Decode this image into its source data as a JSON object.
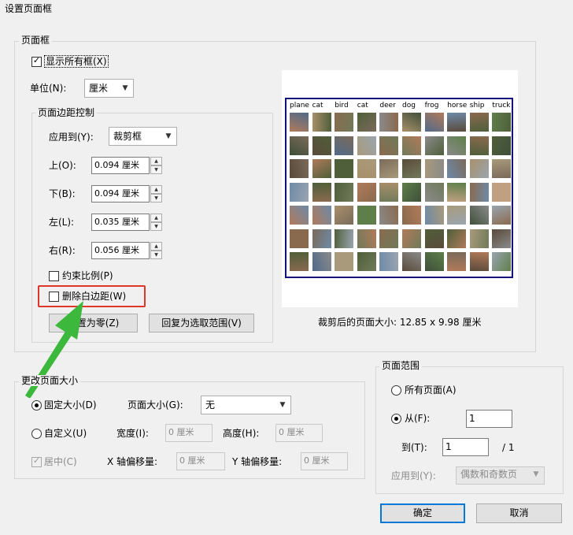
{
  "window": {
    "title": "设置页面框"
  },
  "page_box_group": {
    "title": "页面框",
    "show_all": {
      "label": "显示所有框(X)",
      "checked": true
    },
    "unit": {
      "label": "单位(N):",
      "value": "厘米"
    },
    "margins": {
      "title": "页面边距控制",
      "apply_to": {
        "label": "应用到(Y):",
        "value": "裁剪框"
      },
      "top": {
        "label": "上(O):",
        "value": "0.094 厘米"
      },
      "bottom": {
        "label": "下(B):",
        "value": "0.094 厘米"
      },
      "left": {
        "label": "左(L):",
        "value": "0.035 厘米"
      },
      "right": {
        "label": "右(R):",
        "value": "0.056 厘米"
      },
      "constrain": {
        "label": "约束比例(P)",
        "checked": false
      },
      "remove_white": {
        "label": "删除白边距(W)",
        "checked": false
      },
      "set_zero_label": "设置为零(Z)",
      "revert_label": "回复为选取范围(V)"
    },
    "preview": {
      "classes": [
        "plane",
        "cat",
        "bird",
        "cat",
        "deer",
        "dog",
        "frog",
        "horse",
        "ship",
        "truck"
      ],
      "caption": "裁剪后的页面大小:  12.85 x 9.98 厘米",
      "highlight_color": "#e0352b",
      "arrow_color": "#3cb83c"
    }
  },
  "page_size_group": {
    "title": "更改页面大小",
    "fixed": {
      "label": "固定大小(D)",
      "selected": true
    },
    "page_size": {
      "label": "页面大小(G):",
      "value": "无"
    },
    "custom": {
      "label": "自定义(U)",
      "selected": false
    },
    "width": {
      "label": "宽度(I):",
      "value": "0 厘米"
    },
    "height": {
      "label": "高度(H):",
      "value": "0 厘米"
    },
    "center": {
      "label": "居中(C)",
      "checked": true
    },
    "x_offset": {
      "label": "X 轴偏移量:",
      "value": "0 厘米"
    },
    "y_offset": {
      "label": "Y 轴偏移量:",
      "value": "0 厘米"
    }
  },
  "page_range_group": {
    "title": "页面范围",
    "all_pages": {
      "label": "所有页面(A)",
      "selected": false
    },
    "from": {
      "label": "从(F):",
      "value": "1",
      "selected": true
    },
    "to": {
      "label": "到(T):",
      "value": "1",
      "total": "/ 1"
    },
    "apply_to": {
      "label": "应用到(Y):",
      "value": "偶数和奇数页"
    }
  },
  "buttons": {
    "ok": "确定",
    "cancel": "取消"
  }
}
